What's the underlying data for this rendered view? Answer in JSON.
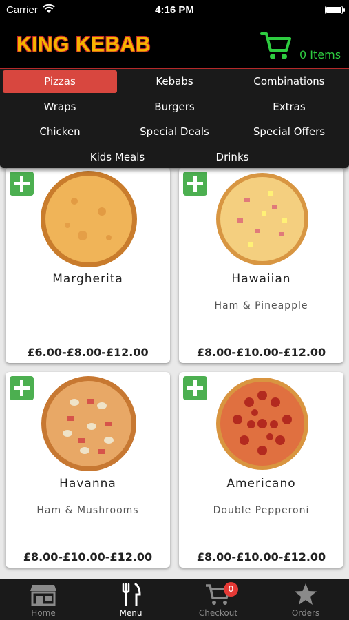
{
  "status_bar": {
    "carrier": "Carrier",
    "time": "4:16 PM"
  },
  "header": {
    "logo": "KING KEBAB",
    "cart_items": "0 Items"
  },
  "categories": [
    {
      "label": "Pizzas",
      "active": true
    },
    {
      "label": "Kebabs"
    },
    {
      "label": "Combinations"
    },
    {
      "label": "Wraps"
    },
    {
      "label": "Burgers"
    },
    {
      "label": "Extras"
    },
    {
      "label": "Chicken"
    },
    {
      "label": "Special Deals"
    },
    {
      "label": "Special Offers"
    },
    {
      "label": "Kids Meals"
    },
    {
      "label": "Drinks"
    }
  ],
  "products": [
    {
      "name": "Margherita",
      "description": "",
      "price": "£6.00-£8.00-£12.00"
    },
    {
      "name": "Hawaiian",
      "description": "Ham & Pineapple",
      "price": "£8.00-£10.00-£12.00"
    },
    {
      "name": "Havanna",
      "description": "Ham & Mushrooms",
      "price": "£8.00-£10.00-£12.00"
    },
    {
      "name": "Americano",
      "description": "Double Pepperoni",
      "price": "£8.00-£10.00-£12.00"
    }
  ],
  "tabs": [
    {
      "label": "Home",
      "icon": "store-icon"
    },
    {
      "label": "Menu",
      "icon": "fork-knife-icon",
      "active": true
    },
    {
      "label": "Checkout",
      "icon": "cart-icon",
      "badge": "0"
    },
    {
      "label": "Orders",
      "icon": "star-icon"
    }
  ],
  "colors": {
    "accent_green": "#4caf50",
    "cart_green": "#2ecc40",
    "active_category": "#d8473f",
    "logo_yellow": "#f5b400",
    "badge_red": "#e53935"
  }
}
